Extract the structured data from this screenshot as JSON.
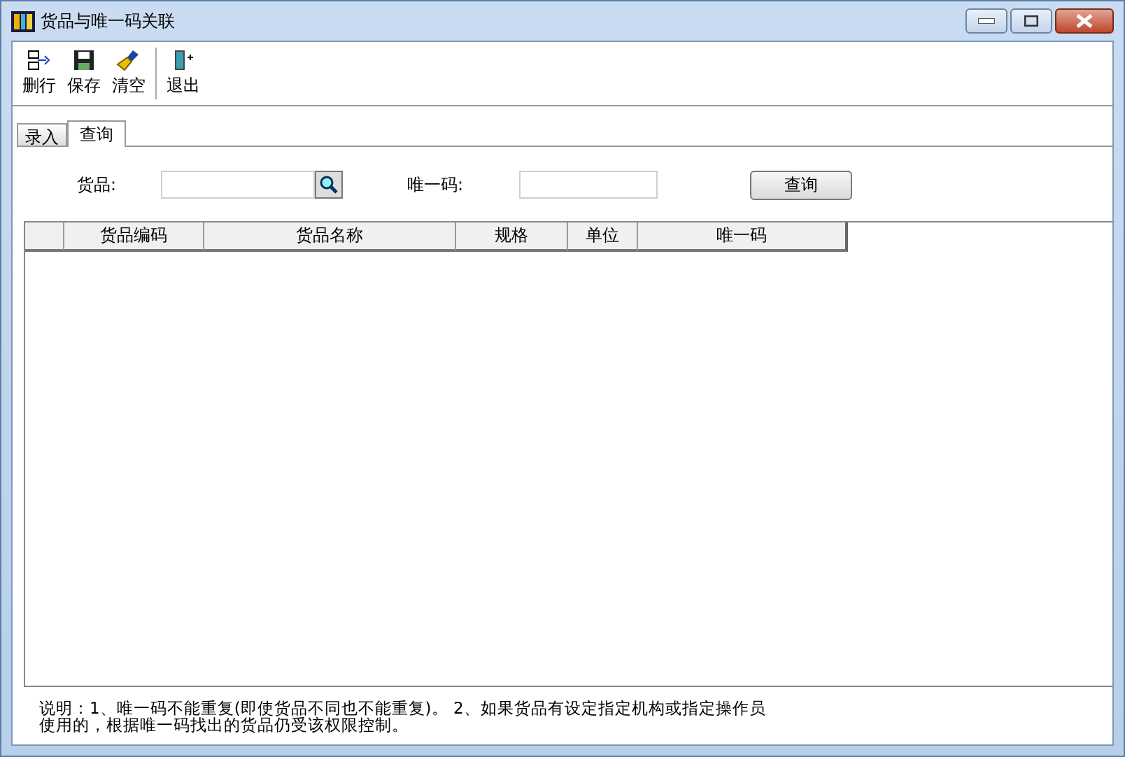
{
  "window": {
    "title": "货品与唯一码关联"
  },
  "toolbar": [
    {
      "label": "删行",
      "kind": "delete-row"
    },
    {
      "label": "保存",
      "kind": "save"
    },
    {
      "label": "清空",
      "kind": "clear"
    },
    {
      "label": "退出",
      "kind": "exit"
    }
  ],
  "tabs": [
    {
      "label": "录入",
      "selected": false
    },
    {
      "label": "查询",
      "selected": true
    }
  ],
  "filters": {
    "goods_label": "货品:",
    "code_label": "唯一码:",
    "query_button": "查询"
  },
  "table": {
    "columns": [
      "",
      "货品编码",
      "货品名称",
      "规格",
      "单位",
      "唯一码"
    ]
  },
  "note": [
    "说明：1、唯一码不能重复(即使货品不同也不能重复)。 2、如果货品有设定指定机构或指定操作员",
    "使用的，根据唯一码找出的货品仍受该权限控制。"
  ]
}
